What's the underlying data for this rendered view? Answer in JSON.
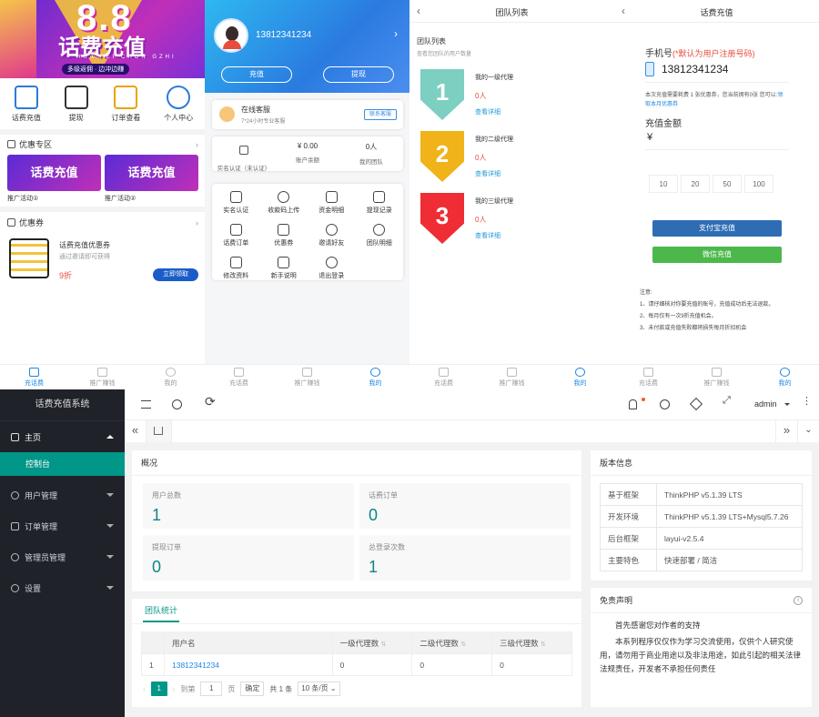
{
  "p1": {
    "banner_big": "8.8",
    "banner_title": "话费充值",
    "banner_sub": "HUA FEI CHON GZHI",
    "banner_slogan": "多级返佣 · 边冲边赚",
    "quick": [
      {
        "label": "话费充值",
        "icon": "phone-icon"
      },
      {
        "label": "提现",
        "icon": "wallet-icon"
      },
      {
        "label": "订单查看",
        "icon": "clipboard-icon"
      },
      {
        "label": "个人中心",
        "icon": "user-badge-icon"
      }
    ],
    "section1": "优惠专区",
    "promo1": "推广活动①",
    "promo2": "推广活动②",
    "section2": "优惠券",
    "coupon_title": "话费充值优惠券",
    "coupon_desc": "通过邀请即可获得",
    "coupon_discount": "9折",
    "coupon_btn": "立即领取",
    "mini_title": "话费充值"
  },
  "p2": {
    "phone": "13812341234",
    "recharge": "充值",
    "withdraw": "提现",
    "service_title": "在线客服",
    "service_desc": "7*24小时专业客服",
    "service_btn": "联系客服",
    "stat_verify": "实名认证（未认证）",
    "balance_value": "¥ 0.00",
    "balance_label": "账户余额",
    "team_value": "0人",
    "team_label": "我的团队",
    "menu": [
      {
        "label": "实名认证",
        "icon": "shield-check-icon"
      },
      {
        "label": "收款码上传",
        "icon": "cloud-upload-icon"
      },
      {
        "label": "资金明细",
        "icon": "document-icon"
      },
      {
        "label": "提现记录",
        "icon": "checklist-icon"
      },
      {
        "label": "话费订单",
        "icon": "phone-order-icon"
      },
      {
        "label": "优惠券",
        "icon": "ticket-icon"
      },
      {
        "label": "邀请好友",
        "icon": "add-user-icon"
      },
      {
        "label": "团队明细",
        "icon": "team-icon"
      },
      {
        "label": "修改资料",
        "icon": "edit-icon"
      },
      {
        "label": "新手说明",
        "icon": "help-doc-icon"
      },
      {
        "label": "退出登录",
        "icon": "power-icon"
      }
    ]
  },
  "p3": {
    "title": "团队列表",
    "list_title": "团队列表",
    "list_sub": "查看您团队的用户数量",
    "levels": [
      {
        "num": "1",
        "name": "我的一级代理",
        "count": "0人",
        "link": "查看详细",
        "color": "#7ccfc1"
      },
      {
        "num": "2",
        "name": "我的二级代理",
        "count": "0人",
        "link": "查看详细",
        "color": "#f0b31a"
      },
      {
        "num": "3",
        "name": "我的三级代理",
        "count": "0人",
        "link": "查看详细",
        "color": "#ef2d35"
      }
    ]
  },
  "p4": {
    "title": "话费充值",
    "phone_label": "手机号",
    "phone_hint": "(*默认为用户注册号码)",
    "phone": "13812341234",
    "note_a": "本次充值需要耗费 1 张优惠券，您当前拥有0张 您可以:",
    "note_b": "领",
    "note_c": "取本月优惠券",
    "amount_label": "充值金额",
    "currency": "¥",
    "amounts": [
      "10",
      "20",
      "50",
      "100"
    ],
    "alipay": "支付宝充值",
    "wechat": "微信充值",
    "notes_title": "注意:",
    "notes": [
      "1、请仔细核对你要充值的账号，充值成功后无法退款。",
      "2、每月仅有一次9折充值机会。",
      "3、未付款或充值失败都将损失每月折扣机会"
    ]
  },
  "tabs": [
    "充话费",
    "推广赚钱",
    "我的"
  ],
  "admin": {
    "system_title": "话费充值系统",
    "user": "admin",
    "menu": [
      {
        "label": "主页",
        "icon": "home-icon"
      },
      {
        "label": "控制台"
      },
      {
        "label": "用户管理",
        "icon": "user-icon"
      },
      {
        "label": "订单管理",
        "icon": "order-icon"
      },
      {
        "label": "管理员管理",
        "icon": "admin-icon"
      },
      {
        "label": "设置",
        "icon": "settings-icon"
      }
    ],
    "overview": {
      "title": "概况",
      "stats": [
        {
          "label": "用户总数",
          "value": "1"
        },
        {
          "label": "话费订单",
          "value": "0"
        },
        {
          "label": "提现订单",
          "value": "0"
        },
        {
          "label": "总登录次数",
          "value": "1"
        }
      ]
    },
    "version": {
      "title": "版本信息",
      "rows": [
        {
          "k": "基于框架",
          "v": "ThinkPHP v5.1.39 LTS"
        },
        {
          "k": "开发环境",
          "v": "ThinkPHP v5.1.39 LTS+Mysql5.7.26"
        },
        {
          "k": "后台框架",
          "v": "layui-v2.5.4"
        },
        {
          "k": "主要特色",
          "v": "快速部署 / 简洁"
        }
      ]
    },
    "disclaimer": {
      "title": "免责声明",
      "p1": "首先感谢您对作者的支持",
      "p2": "本系列程序仅仅作为学习交流使用，仅供个人研究使用，请勿用于商业用途以及非法用途，如此引起的相关法律法规责任，开发者不承担任何责任"
    },
    "team": {
      "tab": "团队统计",
      "headers": [
        "用户名",
        "一级代理数",
        "二级代理数",
        "三级代理数"
      ],
      "rows": [
        [
          "1",
          "13812341234",
          "0",
          "0",
          "0"
        ]
      ]
    },
    "pager": {
      "page": "1",
      "goto": "到第",
      "page_unit": "页",
      "confirm": "确定",
      "total": "共 1 条",
      "per_page": "10 条/页"
    }
  },
  "colors": {
    "accent": "#009688",
    "link": "#1e88e5",
    "teal_value": "#0f8585"
  }
}
